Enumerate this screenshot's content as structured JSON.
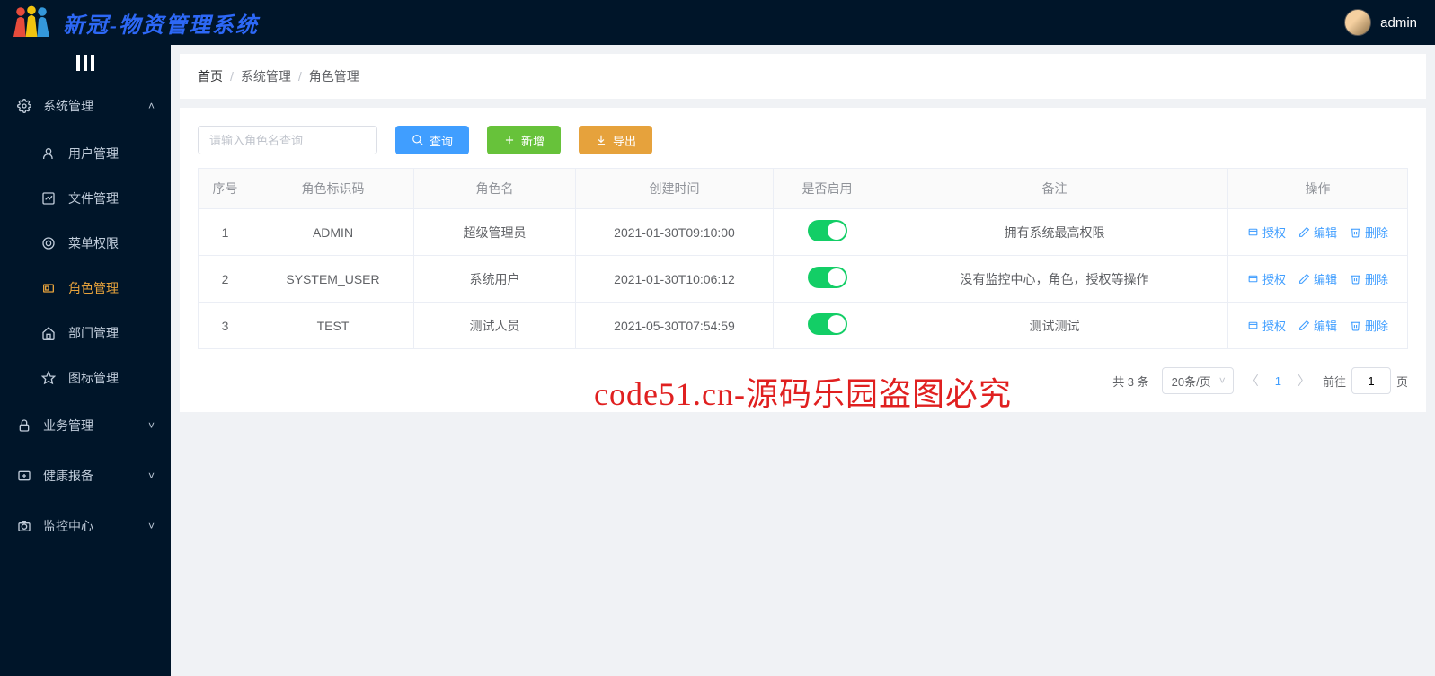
{
  "header": {
    "system_name": "新冠-物资管理系统",
    "user_name": "admin"
  },
  "sidebar": {
    "groups": [
      {
        "label": "系统管理",
        "expanded": true,
        "items": [
          {
            "label": "用户管理",
            "icon": "user"
          },
          {
            "label": "文件管理",
            "icon": "chart"
          },
          {
            "label": "菜单权限",
            "icon": "target"
          },
          {
            "label": "角色管理",
            "icon": "role",
            "active": true
          },
          {
            "label": "部门管理",
            "icon": "dept"
          },
          {
            "label": "图标管理",
            "icon": "star"
          }
        ]
      },
      {
        "label": "业务管理",
        "expanded": false,
        "icon": "lock"
      },
      {
        "label": "健康报备",
        "expanded": false,
        "icon": "health"
      },
      {
        "label": "监控中心",
        "expanded": false,
        "icon": "camera"
      }
    ]
  },
  "breadcrumb": {
    "items": [
      "首页",
      "系统管理",
      "角色管理"
    ]
  },
  "toolbar": {
    "search_placeholder": "请输入角色名查询",
    "search_label": "查询",
    "add_label": "新增",
    "export_label": "导出"
  },
  "table": {
    "headers": {
      "seq": "序号",
      "code": "角色标识码",
      "name": "角色名",
      "time": "创建时间",
      "enable": "是否启用",
      "remark": "备注",
      "action": "操作"
    },
    "rows": [
      {
        "seq": "1",
        "code": "ADMIN",
        "name": "超级管理员",
        "time": "2021-01-30T09:10:00",
        "enabled": true,
        "remark": "拥有系统最高权限"
      },
      {
        "seq": "2",
        "code": "SYSTEM_USER",
        "name": "系统用户",
        "time": "2021-01-30T10:06:12",
        "enabled": true,
        "remark": "没有监控中心，角色，授权等操作"
      },
      {
        "seq": "3",
        "code": "TEST",
        "name": "测试人员",
        "time": "2021-05-30T07:54:59",
        "enabled": true,
        "remark": "测试测试"
      }
    ],
    "actions": {
      "authorize": "授权",
      "edit": "编辑",
      "delete": "删除"
    }
  },
  "pagination": {
    "total_text": "共 3 条",
    "page_size_label": "20条/页",
    "current_page": "1",
    "jump_prefix": "前往",
    "jump_suffix": "页",
    "jump_value": "1"
  },
  "watermark_text": "code51.cn-源码乐园盗图必究"
}
